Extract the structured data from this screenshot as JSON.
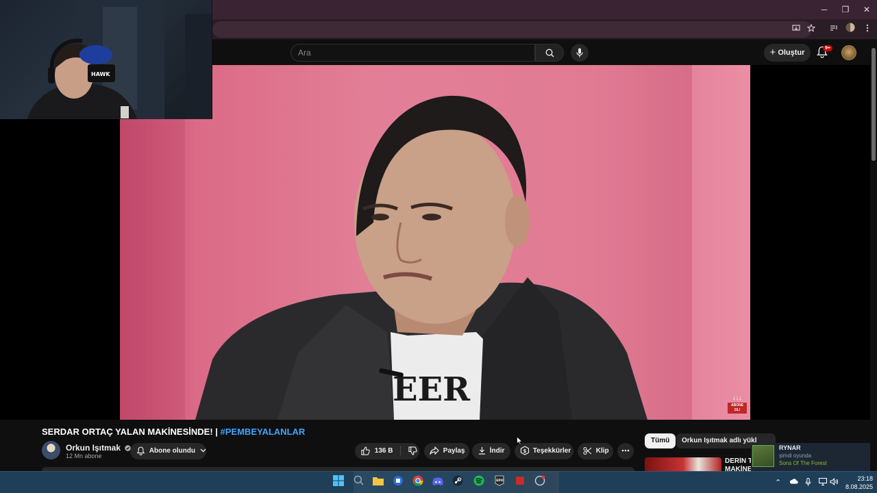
{
  "browser": {
    "window_controls": [
      "─",
      "❐",
      "✕"
    ]
  },
  "header": {
    "search_placeholder": "Ara",
    "create_label": "Oluştur",
    "notification_count": "9+"
  },
  "webcam": {
    "hat_text": "HAWK"
  },
  "video": {
    "corner_badge": "ABONE OL!",
    "shirt_text": "EER"
  },
  "info": {
    "title": "SERDAR ORTAÇ YALAN MAKİNESİNDE! | ",
    "hashtag": "#PEMBEYALANLAR",
    "channel_name": "Orkun Işıtmak",
    "subscribers": "12 Mn abone",
    "subscribe_label": "Abone olundu",
    "likes": "136 B",
    "share_label": "Paylaş",
    "download_label": "İndir",
    "thanks_label": "Teşekkürler",
    "clip_label": "Klip"
  },
  "sidebar": {
    "chip_all": "Tümü",
    "chip_uploads": "Orkun Işıtmak adlı yükl",
    "next_video_title": "DERİN T\nMAKİNE"
  },
  "steam": {
    "name": "RYNAR",
    "status": "şimdi oyunda",
    "game": "Sons Of The Forest"
  },
  "taskbar": {
    "time": "23:18",
    "date": "8.08.2025"
  },
  "colors": {
    "pink_backdrop": "#e17b94",
    "youtube_bg": "#0f0f0f",
    "link_blue": "#3ea6ff",
    "taskbar": "#1f3f58",
    "steam_green": "#90ba3c"
  }
}
